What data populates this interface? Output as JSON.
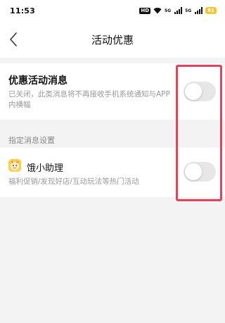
{
  "status_bar": {
    "time": "11:53",
    "hd_label": "HD",
    "sig1_label": "5G",
    "sig2_label": "5G",
    "battery": "81",
    "battery_color": "#f5c431"
  },
  "nav": {
    "back_icon": "chevron-left-icon",
    "title": "活动优惠"
  },
  "promo_setting": {
    "title": "优惠活动消息",
    "description": "已关闭，此类消息将不再接收手机系统通知与APP内横幅",
    "enabled": false
  },
  "section": {
    "label": "指定消息设置"
  },
  "assistant_setting": {
    "icon": "assistant-avatar-icon",
    "title": "饿小助理",
    "description": "福利促销/发现好店/互动玩法等热门活动",
    "enabled": false
  },
  "colors": {
    "highlight": "#e8425a",
    "toggle_off": "#e7e7e7",
    "page_bg": "#f3f3f3"
  }
}
